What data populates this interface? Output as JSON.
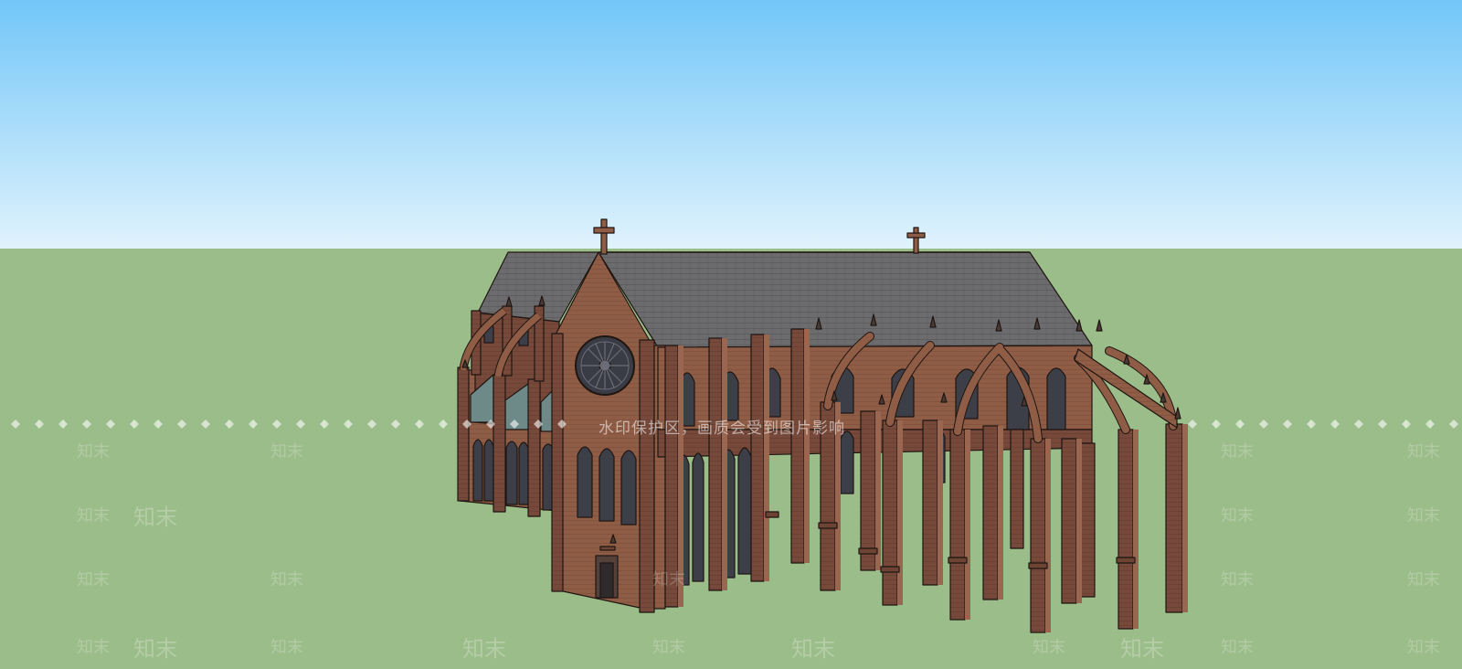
{
  "viewport": {
    "sky_top_color": "#72c6f8",
    "sky_horizon_color": "#e0f3fc",
    "ground_color": "#9bbd8a"
  },
  "model": {
    "brick_color": "#8f5c45",
    "brick_shadow_color": "#6d4434",
    "roof_color": "#6c6c6e",
    "glass_color": "#4a4d57",
    "outline_color": "#1f1612"
  },
  "watermark": {
    "caption": "水印保护区，画质会受到图片影响",
    "logo_text": "知末"
  }
}
